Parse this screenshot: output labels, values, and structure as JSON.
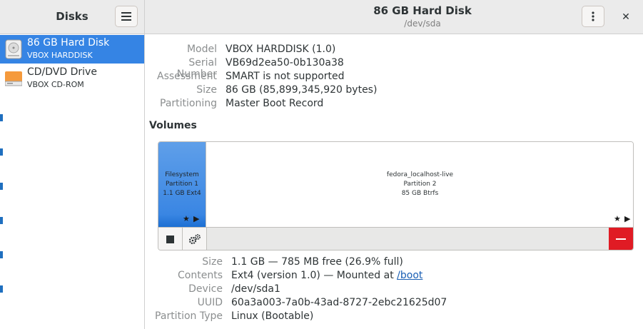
{
  "app": {
    "title": "Disks"
  },
  "header": {
    "title": "86 GB Hard Disk",
    "subtitle": "/dev/sda"
  },
  "sidebar": {
    "items": [
      {
        "name": "86 GB Hard Disk",
        "sub": "VBOX HARDDISK",
        "icon": "hard-disk-icon",
        "selected": true
      },
      {
        "name": "CD/DVD Drive",
        "sub": "VBOX CD-ROM",
        "icon": "optical-drive-icon",
        "selected": false
      }
    ]
  },
  "drive_info": {
    "model_label": "Model",
    "model": "VBOX HARDDISK (1.0)",
    "serial_label": "Serial Number",
    "serial": "VB69d2ea50-0b130a38",
    "assessment_label": "Assessment",
    "assessment": "SMART is not supported",
    "size_label": "Size",
    "size": "86 GB (85,899,345,920 bytes)",
    "partitioning_label": "Partitioning",
    "partitioning": "Master Boot Record"
  },
  "volumes": {
    "heading": "Volumes",
    "partitions": [
      {
        "line1": "Filesystem",
        "line2": "Partition 1",
        "line3": "1.1 GB Ext4",
        "selected": true
      },
      {
        "line1": "fedora_localhost-live",
        "line2": "Partition 2",
        "line3": "85 GB Btrfs",
        "selected": false
      }
    ]
  },
  "partition_info": {
    "size_label": "Size",
    "size": "1.1 GB — 785 MB free (26.9% full)",
    "contents_label": "Contents",
    "contents_prefix": "Ext4 (version 1.0) — Mounted at ",
    "contents_link": "/boot",
    "device_label": "Device",
    "device": "/dev/sda1",
    "uuid_label": "UUID",
    "uuid": "60a3a003-7a0b-43ad-8727-2ebc21625d07",
    "type_label": "Partition Type",
    "type": "Linux (Bootable)"
  },
  "colors": {
    "accent": "#3584e4",
    "danger": "#e01b24",
    "header_bg": "#ebebeb"
  }
}
